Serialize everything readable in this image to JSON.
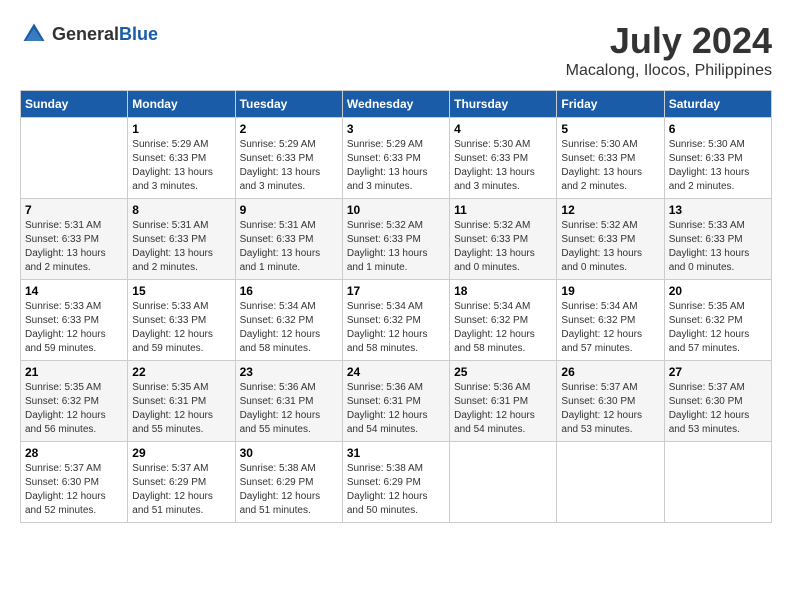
{
  "header": {
    "logo_general": "General",
    "logo_blue": "Blue",
    "month_year": "July 2024",
    "location": "Macalong, Ilocos, Philippines"
  },
  "calendar": {
    "days_of_week": [
      "Sunday",
      "Monday",
      "Tuesday",
      "Wednesday",
      "Thursday",
      "Friday",
      "Saturday"
    ],
    "weeks": [
      [
        {
          "day": "",
          "sunrise": "",
          "sunset": "",
          "daylight": ""
        },
        {
          "day": "1",
          "sunrise": "Sunrise: 5:29 AM",
          "sunset": "Sunset: 6:33 PM",
          "daylight": "Daylight: 13 hours and 3 minutes."
        },
        {
          "day": "2",
          "sunrise": "Sunrise: 5:29 AM",
          "sunset": "Sunset: 6:33 PM",
          "daylight": "Daylight: 13 hours and 3 minutes."
        },
        {
          "day": "3",
          "sunrise": "Sunrise: 5:29 AM",
          "sunset": "Sunset: 6:33 PM",
          "daylight": "Daylight: 13 hours and 3 minutes."
        },
        {
          "day": "4",
          "sunrise": "Sunrise: 5:30 AM",
          "sunset": "Sunset: 6:33 PM",
          "daylight": "Daylight: 13 hours and 3 minutes."
        },
        {
          "day": "5",
          "sunrise": "Sunrise: 5:30 AM",
          "sunset": "Sunset: 6:33 PM",
          "daylight": "Daylight: 13 hours and 2 minutes."
        },
        {
          "day": "6",
          "sunrise": "Sunrise: 5:30 AM",
          "sunset": "Sunset: 6:33 PM",
          "daylight": "Daylight: 13 hours and 2 minutes."
        }
      ],
      [
        {
          "day": "7",
          "sunrise": "Sunrise: 5:31 AM",
          "sunset": "Sunset: 6:33 PM",
          "daylight": "Daylight: 13 hours and 2 minutes."
        },
        {
          "day": "8",
          "sunrise": "Sunrise: 5:31 AM",
          "sunset": "Sunset: 6:33 PM",
          "daylight": "Daylight: 13 hours and 2 minutes."
        },
        {
          "day": "9",
          "sunrise": "Sunrise: 5:31 AM",
          "sunset": "Sunset: 6:33 PM",
          "daylight": "Daylight: 13 hours and 1 minute."
        },
        {
          "day": "10",
          "sunrise": "Sunrise: 5:32 AM",
          "sunset": "Sunset: 6:33 PM",
          "daylight": "Daylight: 13 hours and 1 minute."
        },
        {
          "day": "11",
          "sunrise": "Sunrise: 5:32 AM",
          "sunset": "Sunset: 6:33 PM",
          "daylight": "Daylight: 13 hours and 0 minutes."
        },
        {
          "day": "12",
          "sunrise": "Sunrise: 5:32 AM",
          "sunset": "Sunset: 6:33 PM",
          "daylight": "Daylight: 13 hours and 0 minutes."
        },
        {
          "day": "13",
          "sunrise": "Sunrise: 5:33 AM",
          "sunset": "Sunset: 6:33 PM",
          "daylight": "Daylight: 13 hours and 0 minutes."
        }
      ],
      [
        {
          "day": "14",
          "sunrise": "Sunrise: 5:33 AM",
          "sunset": "Sunset: 6:33 PM",
          "daylight": "Daylight: 12 hours and 59 minutes."
        },
        {
          "day": "15",
          "sunrise": "Sunrise: 5:33 AM",
          "sunset": "Sunset: 6:33 PM",
          "daylight": "Daylight: 12 hours and 59 minutes."
        },
        {
          "day": "16",
          "sunrise": "Sunrise: 5:34 AM",
          "sunset": "Sunset: 6:32 PM",
          "daylight": "Daylight: 12 hours and 58 minutes."
        },
        {
          "day": "17",
          "sunrise": "Sunrise: 5:34 AM",
          "sunset": "Sunset: 6:32 PM",
          "daylight": "Daylight: 12 hours and 58 minutes."
        },
        {
          "day": "18",
          "sunrise": "Sunrise: 5:34 AM",
          "sunset": "Sunset: 6:32 PM",
          "daylight": "Daylight: 12 hours and 58 minutes."
        },
        {
          "day": "19",
          "sunrise": "Sunrise: 5:34 AM",
          "sunset": "Sunset: 6:32 PM",
          "daylight": "Daylight: 12 hours and 57 minutes."
        },
        {
          "day": "20",
          "sunrise": "Sunrise: 5:35 AM",
          "sunset": "Sunset: 6:32 PM",
          "daylight": "Daylight: 12 hours and 57 minutes."
        }
      ],
      [
        {
          "day": "21",
          "sunrise": "Sunrise: 5:35 AM",
          "sunset": "Sunset: 6:32 PM",
          "daylight": "Daylight: 12 hours and 56 minutes."
        },
        {
          "day": "22",
          "sunrise": "Sunrise: 5:35 AM",
          "sunset": "Sunset: 6:31 PM",
          "daylight": "Daylight: 12 hours and 55 minutes."
        },
        {
          "day": "23",
          "sunrise": "Sunrise: 5:36 AM",
          "sunset": "Sunset: 6:31 PM",
          "daylight": "Daylight: 12 hours and 55 minutes."
        },
        {
          "day": "24",
          "sunrise": "Sunrise: 5:36 AM",
          "sunset": "Sunset: 6:31 PM",
          "daylight": "Daylight: 12 hours and 54 minutes."
        },
        {
          "day": "25",
          "sunrise": "Sunrise: 5:36 AM",
          "sunset": "Sunset: 6:31 PM",
          "daylight": "Daylight: 12 hours and 54 minutes."
        },
        {
          "day": "26",
          "sunrise": "Sunrise: 5:37 AM",
          "sunset": "Sunset: 6:30 PM",
          "daylight": "Daylight: 12 hours and 53 minutes."
        },
        {
          "day": "27",
          "sunrise": "Sunrise: 5:37 AM",
          "sunset": "Sunset: 6:30 PM",
          "daylight": "Daylight: 12 hours and 53 minutes."
        }
      ],
      [
        {
          "day": "28",
          "sunrise": "Sunrise: 5:37 AM",
          "sunset": "Sunset: 6:30 PM",
          "daylight": "Daylight: 12 hours and 52 minutes."
        },
        {
          "day": "29",
          "sunrise": "Sunrise: 5:37 AM",
          "sunset": "Sunset: 6:29 PM",
          "daylight": "Daylight: 12 hours and 51 minutes."
        },
        {
          "day": "30",
          "sunrise": "Sunrise: 5:38 AM",
          "sunset": "Sunset: 6:29 PM",
          "daylight": "Daylight: 12 hours and 51 minutes."
        },
        {
          "day": "31",
          "sunrise": "Sunrise: 5:38 AM",
          "sunset": "Sunset: 6:29 PM",
          "daylight": "Daylight: 12 hours and 50 minutes."
        },
        {
          "day": "",
          "sunrise": "",
          "sunset": "",
          "daylight": ""
        },
        {
          "day": "",
          "sunrise": "",
          "sunset": "",
          "daylight": ""
        },
        {
          "day": "",
          "sunrise": "",
          "sunset": "",
          "daylight": ""
        }
      ]
    ]
  }
}
